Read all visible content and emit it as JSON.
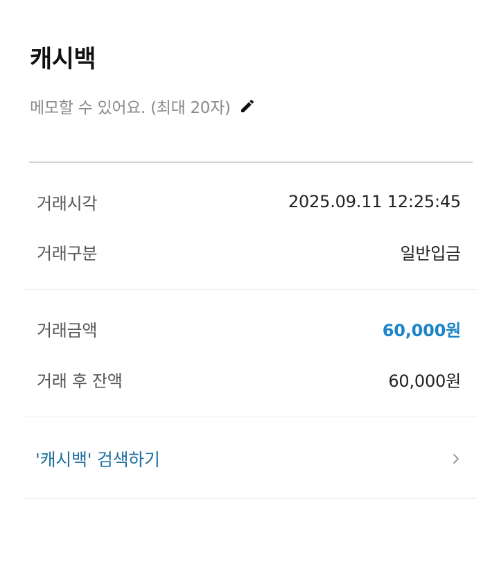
{
  "header": {
    "title": "캐시백",
    "memo_placeholder": "메모할 수 있어요. (최대 20자)",
    "edit_icon": "pencil-icon"
  },
  "details": {
    "time_label": "거래시각",
    "time_value": "2025.09.11 12:25:45",
    "type_label": "거래구분",
    "type_value": "일반입금",
    "amount_label": "거래금액",
    "amount_value": "60,000원",
    "balance_label": "거래 후 잔액",
    "balance_value": "60,000원"
  },
  "search_link": {
    "label": "'캐시백' 검색하기",
    "icon": "chevron-right-icon"
  },
  "colors": {
    "accent": "#1c84c6",
    "link": "#1f6fa0",
    "muted": "#8a8a8a"
  }
}
